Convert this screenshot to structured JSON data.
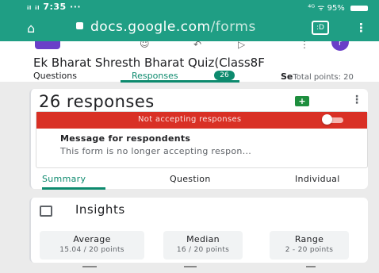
{
  "status_bar": {
    "signal": "ᵢₗ ᵢₗ",
    "time": "7:35",
    "dots": "···",
    "right": "⁴ᴳ ᯤ 95%"
  },
  "browser": {
    "url_domain": "docs.google.com",
    "url_path": "/forms",
    "tabs_count": ":D"
  },
  "form": {
    "title": "Ek Bharat Shresth Bharat Quiz(Class8F",
    "avatar_letter": "r",
    "tabs": {
      "questions": "Questions",
      "responses": "Responses",
      "responses_count": "26",
      "settings_partial": "Se",
      "total_points": "Total points: 20"
    }
  },
  "responses_card": {
    "heading": "26 responses",
    "banner": {
      "status": "Not accepting responses",
      "message_label": "Message for respondents",
      "message_text": "This form is no longer accepting respon..."
    },
    "subtabs": [
      "Summary",
      "Question",
      "Individual"
    ]
  },
  "insights_card": {
    "heading": "Insights",
    "stats": [
      {
        "label": "Average",
        "value": "15.04 / 20 points"
      },
      {
        "label": "Median",
        "value": "16 / 20 points"
      },
      {
        "label": "Range",
        "value": "2 - 20 points"
      }
    ]
  },
  "colors": {
    "browser_green": "#1f9e84",
    "form_accent": "#0d8a6e",
    "banner_red": "#d93025",
    "purple": "#6a3fc8"
  }
}
